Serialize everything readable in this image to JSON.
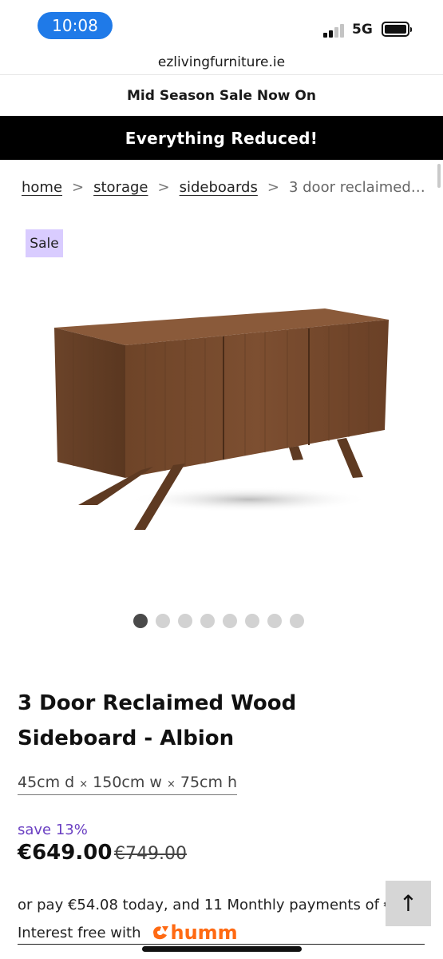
{
  "status_bar": {
    "time": "10:08",
    "network": "5G",
    "accent_color": "#1f7ae8"
  },
  "browser": {
    "url": "ezlivingfurniture.ie"
  },
  "promo": {
    "line": "Mid Season Sale Now On",
    "banner": "Everything Reduced!"
  },
  "breadcrumb": {
    "items": [
      "home",
      "storage",
      "sideboards"
    ],
    "separator": ">",
    "current": "3 door reclaimed …"
  },
  "badge": {
    "label": "Sale",
    "color": "#d9ccff"
  },
  "gallery": {
    "image": "sideboard-photo",
    "dot_count": 8,
    "active_index": 0
  },
  "product": {
    "title": "3 Door Reclaimed Wood Sideboard - Albion",
    "dimensions": {
      "depth": "45cm d",
      "width": "150cm w",
      "height": "75cm h",
      "separator": "×"
    },
    "save_text": "save 13%",
    "price_now": "€649.00",
    "price_was": "€749.00"
  },
  "finance": {
    "instalment_text": "or pay €54.08 today, and 11 Monthly payments of €5",
    "interest_text": "Interest free with",
    "provider": "humm",
    "provider_color": "#ff6a13"
  },
  "controls": {
    "back_to_top_icon": "arrow-up-icon",
    "back_to_top_glyph": "↑"
  }
}
